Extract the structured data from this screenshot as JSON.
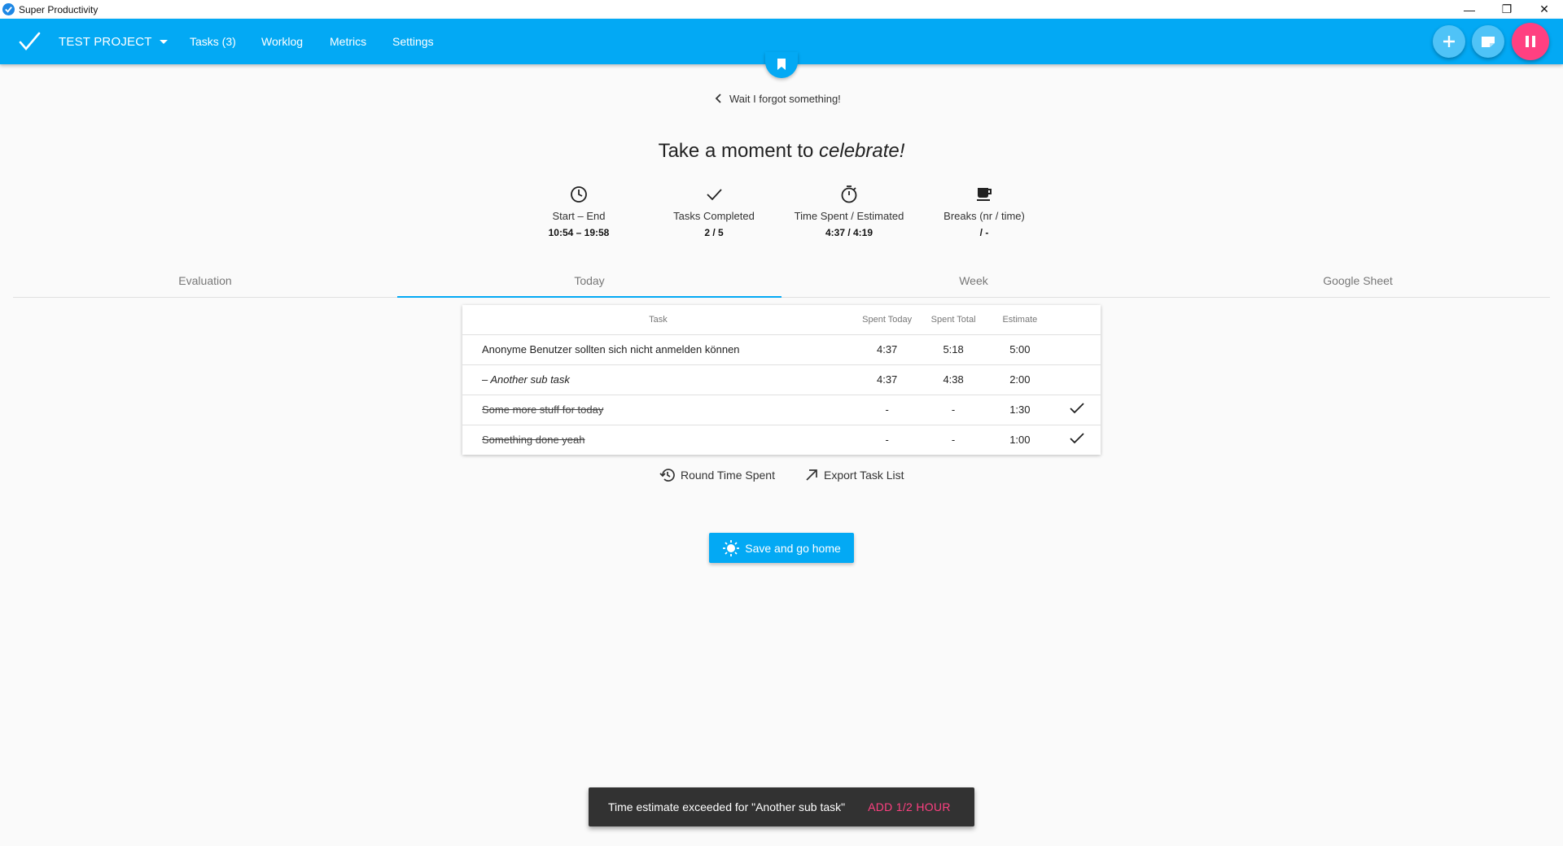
{
  "window": {
    "title": "Super Productivity",
    "controls": {
      "minimize": "—",
      "restore": "❐",
      "close": "✕"
    }
  },
  "appbar": {
    "project": "TEST PROJECT",
    "nav": [
      "Tasks (3)",
      "Worklog",
      "Metrics",
      "Settings"
    ],
    "icons": [
      "add-icon",
      "note-icon",
      "pause-icon",
      "bookmark-icon"
    ],
    "accent_color": "#03a9f4",
    "pause_color": "#ff4081"
  },
  "back_link": "Wait I forgot something!",
  "headline": {
    "lead": "Take a moment to ",
    "emphasis": "celebrate!"
  },
  "stats": [
    {
      "icon": "clock-icon",
      "label": "Start – End",
      "value": "10:54 – 19:58"
    },
    {
      "icon": "check-icon",
      "label": "Tasks Completed",
      "value": "2 / 5"
    },
    {
      "icon": "timer-icon",
      "label": "Time Spent / Estimated",
      "value": "4:37 / 4:19"
    },
    {
      "icon": "coffee-icon",
      "label": "Breaks (nr / time)",
      "value": "/ -"
    }
  ],
  "tabs": [
    "Evaluation",
    "Today",
    "Week",
    "Google Sheet"
  ],
  "active_tab": "Today",
  "table": {
    "headers": [
      "Task",
      "Spent Today",
      "Spent Total",
      "Estimate",
      ""
    ],
    "rows": [
      {
        "task": "Anonyme Benutzer sollten sich nicht anmelden können",
        "spent_today": "4:37",
        "spent_total": "5:18",
        "estimate": "5:00",
        "done": false,
        "subtask": false
      },
      {
        "task": "– Another sub task",
        "spent_today": "4:37",
        "spent_total": "4:38",
        "estimate": "2:00",
        "done": false,
        "subtask": true
      },
      {
        "task": "Some more stuff for today",
        "spent_today": "-",
        "spent_total": "-",
        "estimate": "1:30",
        "done": true,
        "subtask": false
      },
      {
        "task": "Something done yeah",
        "spent_today": "-",
        "spent_total": "-",
        "estimate": "1:00",
        "done": true,
        "subtask": false
      }
    ]
  },
  "actions": {
    "round": "Round Time Spent",
    "export": "Export Task List"
  },
  "save_button": "Save and go home",
  "snackbar": {
    "message": "Time estimate exceeded for \"Another sub task\"",
    "action": "ADD 1/2 HOUR",
    "action_color": "#ff4081"
  }
}
